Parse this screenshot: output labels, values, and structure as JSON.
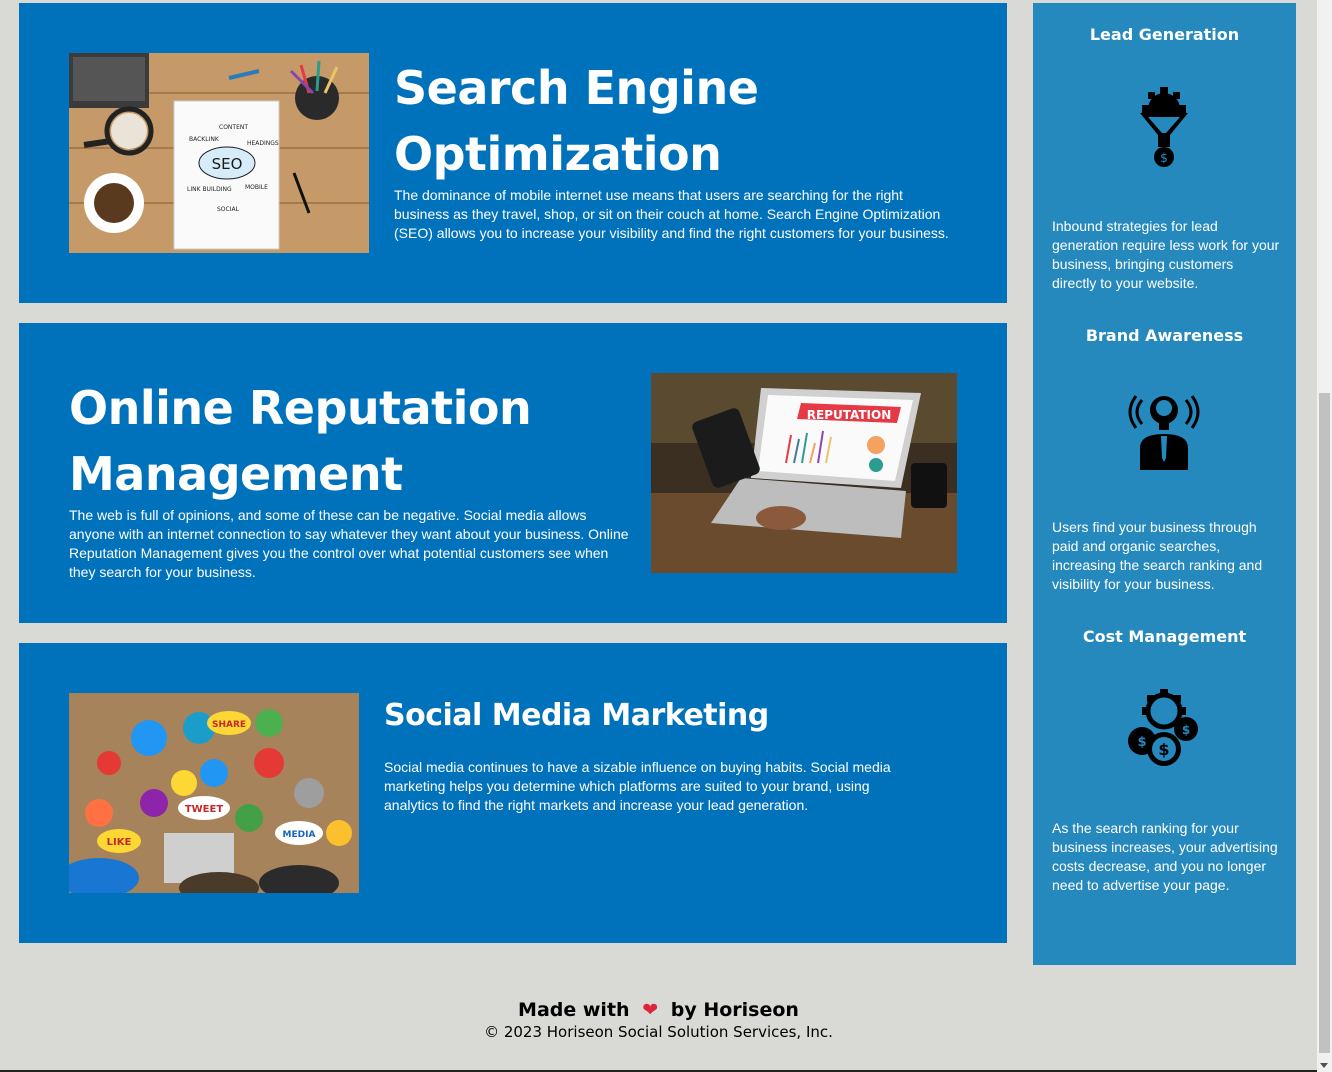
{
  "sections": [
    {
      "title": "Search Engine Optimization",
      "text": "The dominance of mobile internet use means that users are searching for the right business as they travel, shop, or sit on their couch at home. Search Engine Optimization (SEO) allows you to increase your visibility and find the right customers for your business.",
      "image": "seo-notebook-image"
    },
    {
      "title": "Online Reputation Management",
      "text": "The web is full of opinions, and some of these can be negative. Social media allows anyone with an internet connection to say whatever they want about your business. Online Reputation Management gives you the control over what potential customers see when they search for your business.",
      "image": "reputation-laptop-image",
      "image_label": "REPUTATION"
    },
    {
      "title": "Social Media Marketing",
      "text": "Social media continues to have a sizable influence on buying habits. Social media marketing helps you determine which platforms are suited to your brand, using analytics to find the right markets and increase your lead generation.",
      "image": "social-media-table-image",
      "image_labels": [
        "SHARE",
        "TWEET",
        "LIKE",
        "MEDIA"
      ]
    }
  ],
  "benefits": [
    {
      "title": "Lead Generation",
      "icon": "lead-funnel-icon",
      "text": "Inbound strategies for lead generation require less work for your business, bringing customers directly to your website."
    },
    {
      "title": "Brand Awareness",
      "icon": "lightbulb-person-icon",
      "text": "Users find your business through paid and organic searches, increasing the search ranking and visibility for your business."
    },
    {
      "title": "Cost Management",
      "icon": "gear-coins-icon",
      "text": "As the search ranking for your business increases, your advertising costs decrease, and you no longer need to advertise your page."
    }
  ],
  "footer": {
    "made_with": "Made with",
    "heart": "❤",
    "by": "by Horiseon",
    "copyright": "© 2023 Horiseon Social Solution Services, Inc."
  },
  "colors": {
    "section_bg": "#0072bb",
    "sidebar_bg": "#2589bd",
    "page_bg": "#d9dad6"
  }
}
